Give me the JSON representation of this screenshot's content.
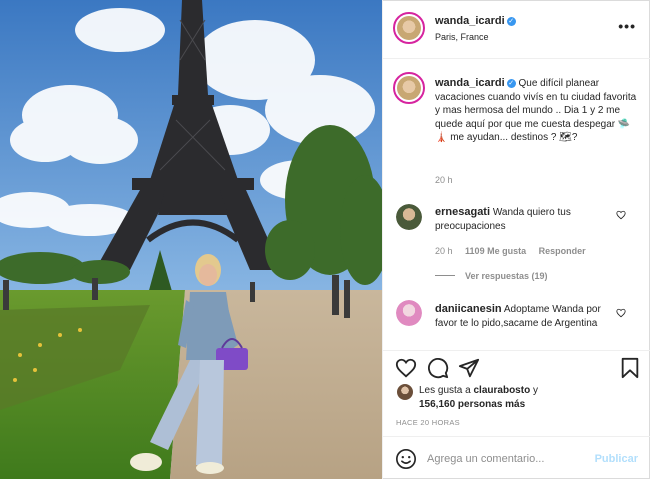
{
  "post": {
    "username": "wanda_icardi",
    "location": "Paris, France",
    "more_label": "•••",
    "verified_mark": "✓"
  },
  "caption": {
    "username": "wanda_icardi",
    "text": "Que difícil planear vacaciones cuando vivís en tu ciudad favorita y mas hermosa del mundo .. Dia 1 y 2 me quede aquí por que me cuesta despegar 🛸 🗼 me ayudan... destinos ? 🗺?",
    "time": "20 h"
  },
  "comments": [
    {
      "username": "ernesagati",
      "text": "Wanda quiero tus preocupaciones",
      "time": "20 h",
      "likes": "1109 Me gusta",
      "reply": "Responder",
      "view_replies": "Ver respuestas (19)"
    },
    {
      "username": "daniicanesin",
      "text": "Adoptame Wanda por favor te lo pido,sacame de Argentina"
    }
  ],
  "likes": {
    "prefix": "Les gusta a",
    "user": "claurabosto",
    "connector": "y",
    "count": "156,160 personas más"
  },
  "timestamp": "HACE 20 HORAS",
  "composer": {
    "placeholder": "Agrega un comentario...",
    "publish": "Publicar"
  },
  "icons": [
    "heart-icon",
    "comment-icon",
    "share-icon",
    "bookmark-icon",
    "emoji-icon",
    "more-icon",
    "verified-icon"
  ],
  "colors": {
    "link_blue": "#b2dffc",
    "verified_blue": "#3897f0",
    "secondary_text": "#8e8e8e",
    "story_ring": "#d6249f"
  }
}
